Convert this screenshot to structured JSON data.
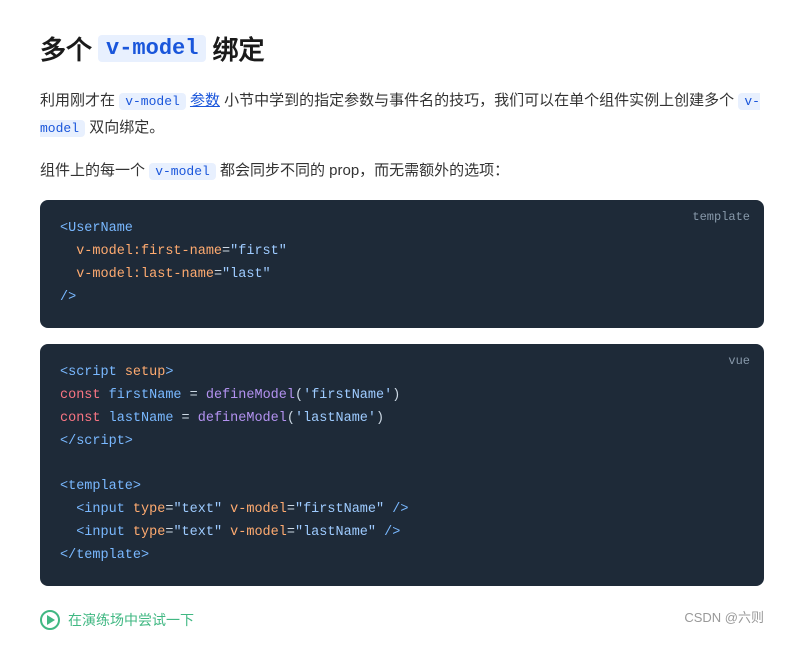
{
  "title": {
    "prefix": "多个",
    "highlight": "v-model",
    "suffix": "绑定"
  },
  "prose1": {
    "before": "利用刚才在",
    "code1": "v-model",
    "link_text": "参数",
    "middle": "小节中学到的指定参数与事件名的技巧，我们可以在单个组件实例上创建多个",
    "code2": "v-model",
    "after": "双向绑定。"
  },
  "prose2": {
    "before": "组件上的每一个",
    "code": "v-model",
    "after": "都会同步不同的 prop，而无需额外的选项："
  },
  "code_block_1": {
    "lang": "template",
    "lines": [
      {
        "type": "template",
        "content": "<UserName"
      },
      {
        "type": "template",
        "content": "  v-model:first-name=\"first\""
      },
      {
        "type": "template",
        "content": "  v-model:last-name=\"last\""
      },
      {
        "type": "template",
        "content": "/>"
      }
    ]
  },
  "code_block_2": {
    "lang": "vue",
    "lines": [
      {
        "type": "script-open"
      },
      {
        "type": "const-define",
        "varName": "firstName",
        "modelName": "firstName"
      },
      {
        "type": "const-define",
        "varName": "lastName",
        "modelName": "lastName"
      },
      {
        "type": "script-close"
      },
      {
        "type": "blank"
      },
      {
        "type": "template-open"
      },
      {
        "type": "input-line",
        "model": "firstName"
      },
      {
        "type": "input-line",
        "model": "lastName"
      },
      {
        "type": "template-close"
      }
    ]
  },
  "playground": {
    "label": "在演练场中尝试一下"
  },
  "footer": {
    "credit": "CSDN @六则"
  }
}
